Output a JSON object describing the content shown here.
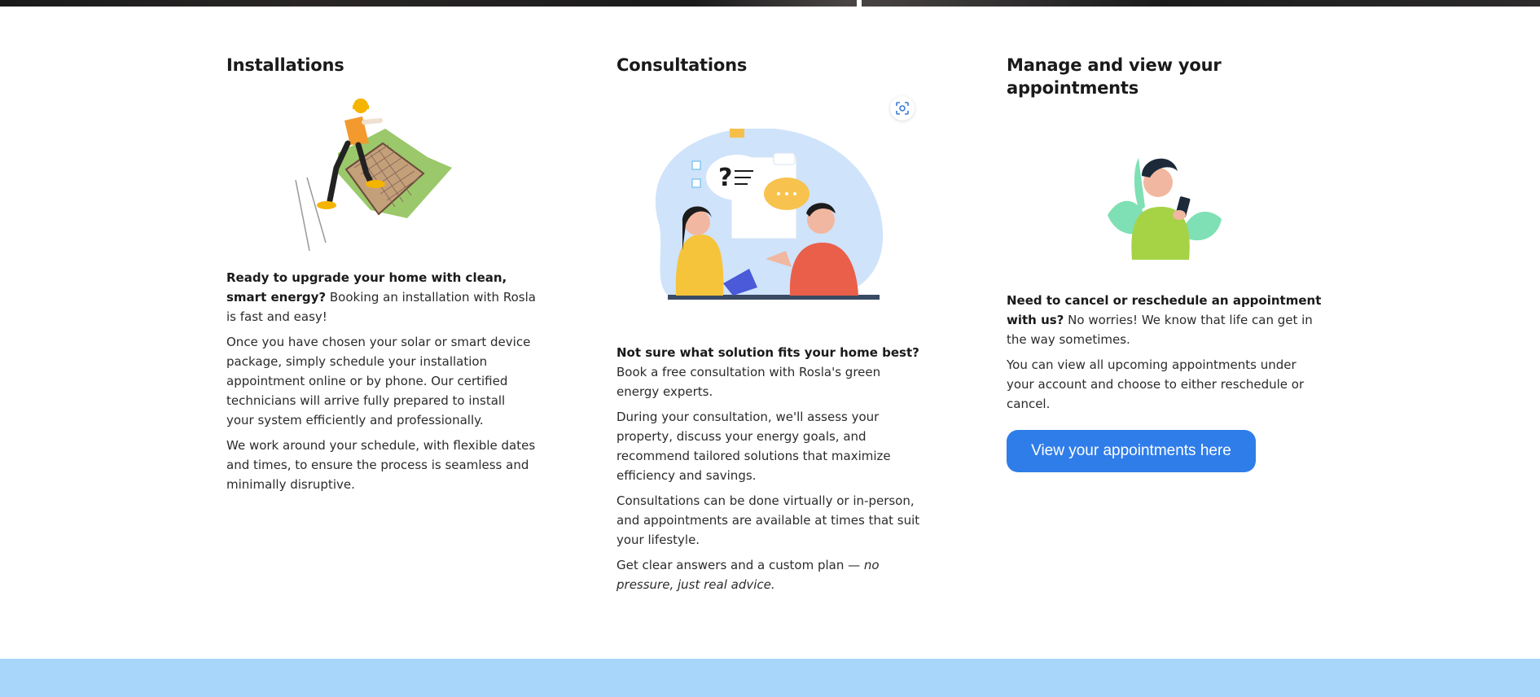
{
  "sections": [
    {
      "title": "Installations",
      "illustration_icon": "solar-installer-illustration",
      "lead_bold": "Ready to upgrade your home with clean, smart energy?",
      "lead_rest": " Booking an installation with Rosla is fast and easy!",
      "paragraphs": [
        "Once you have chosen your solar or smart device package, simply schedule your installation appointment online or by phone. Our certified technicians will arrive fully prepared to install your system efficiently and professionally.",
        "We work around your schedule, with flexible dates and times, to ensure the process is seamless and minimally disruptive."
      ]
    },
    {
      "title": "Consultations",
      "illustration_icon": "consultation-illustration",
      "lead_bold": "Not sure what solution fits your home best?",
      "lead_rest": " Book a free consultation with Rosla's green energy experts.",
      "paragraphs": [
        "During your consultation, we'll assess your property, discuss your energy goals, and recommend tailored solutions that maximize efficiency and savings.",
        "Consultations can be done virtually or in-person, and appointments are available at times that suit your lifestyle."
      ],
      "closing_plain": "Get clear answers and a custom plan — ",
      "closing_italic": "no pressure, just real advice."
    },
    {
      "title": "Manage and view your appointments",
      "illustration_icon": "phone-user-illustration",
      "lead_bold": "Need to cancel or reschedule an appointment with us?",
      "lead_rest": " No worries! We know that life can get in the way sometimes.",
      "paragraphs": [
        "You can view all upcoming appointments under your account and choose to either reschedule or cancel."
      ],
      "button_label": "View your appointments here"
    }
  ],
  "colors": {
    "button": "#2f7de9",
    "bottom_band": "#a8d6fb",
    "heading": "#1a1a1a"
  },
  "image_tool_icon": "visual-search-icon"
}
